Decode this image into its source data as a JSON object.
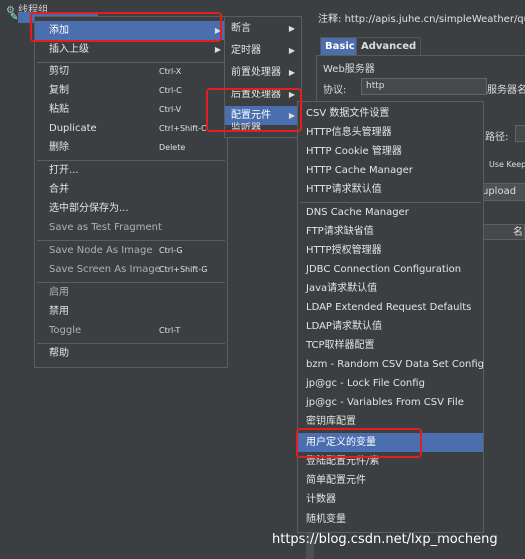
{
  "tree": {
    "root_label": "线程组"
  },
  "right_panel": {
    "comment_label": "注释:",
    "comment_value": "http://apis.juhe.cn/simpleWeather/query",
    "tabs": [
      {
        "label": "Basic"
      },
      {
        "label": "Advanced"
      }
    ],
    "web_server_label": "Web服务器",
    "protocol_label": "协议:",
    "protocol_value": "http",
    "server_label": "服务器名",
    "path_label": "路径:",
    "keepalive_label": "Use Keep",
    "upload_label": "upload",
    "name_label": "名"
  },
  "menu_main": {
    "items": [
      {
        "label": "添加",
        "shortcut": "",
        "submenu": true
      },
      {
        "label": "插入上级",
        "shortcut": "",
        "submenu": true
      },
      {
        "label": "剪切",
        "shortcut": "Ctrl-X"
      },
      {
        "label": "复制",
        "shortcut": "Ctrl-C"
      },
      {
        "label": "粘贴",
        "shortcut": "Ctrl-V"
      },
      {
        "label": "Duplicate",
        "shortcut": "Ctrl+Shift-C"
      },
      {
        "label": "删除",
        "shortcut": "Delete"
      },
      {
        "label": "打开...",
        "shortcut": ""
      },
      {
        "label": "合并",
        "shortcut": ""
      },
      {
        "label": "选中部分保存为...",
        "shortcut": ""
      },
      {
        "label": "Save as Test Fragment",
        "shortcut": ""
      },
      {
        "label": "Save Node As Image",
        "shortcut": "Ctrl-G"
      },
      {
        "label": "Save Screen As Image",
        "shortcut": "Ctrl+Shift-G"
      },
      {
        "label": "启用",
        "shortcut": ""
      },
      {
        "label": "禁用",
        "shortcut": ""
      },
      {
        "label": "Toggle",
        "shortcut": "Ctrl-T"
      },
      {
        "label": "帮助",
        "shortcut": ""
      }
    ]
  },
  "menu_add": {
    "items": [
      {
        "label": "断言"
      },
      {
        "label": "定时器"
      },
      {
        "label": "前置处理器"
      },
      {
        "label": "后置处理器"
      },
      {
        "label": "配置元件"
      },
      {
        "label": "监听器"
      }
    ]
  },
  "menu_config": {
    "items": [
      {
        "label": "CSV 数据文件设置"
      },
      {
        "label": "HTTP信息头管理器"
      },
      {
        "label": "HTTP Cookie 管理器"
      },
      {
        "label": "HTTP Cache Manager"
      },
      {
        "label": "HTTP请求默认值"
      },
      {
        "label": "DNS Cache Manager"
      },
      {
        "label": "FTP请求缺省值"
      },
      {
        "label": "HTTP授权管理器"
      },
      {
        "label": "JDBC Connection Configuration"
      },
      {
        "label": "Java请求默认值"
      },
      {
        "label": "LDAP Extended Request Defaults"
      },
      {
        "label": "LDAP请求默认值"
      },
      {
        "label": "TCP取样器配置"
      },
      {
        "label": "bzm - Random CSV Data Set Config"
      },
      {
        "label": "jp@gc - Lock File Config"
      },
      {
        "label": "jp@gc - Variables From CSV File"
      },
      {
        "label": "密钥库配置"
      },
      {
        "label": "用户定义的变量"
      },
      {
        "label": "登陆配置元件/素"
      },
      {
        "label": "简单配置元件"
      },
      {
        "label": "计数器"
      },
      {
        "label": "随机变量"
      }
    ]
  },
  "watermark": "https://blog.csdn.net/lxp_mocheng",
  "colors": {
    "selection": "#4b6eaf",
    "highlight_box": "#e21e1e",
    "background": "#3c3f41"
  }
}
